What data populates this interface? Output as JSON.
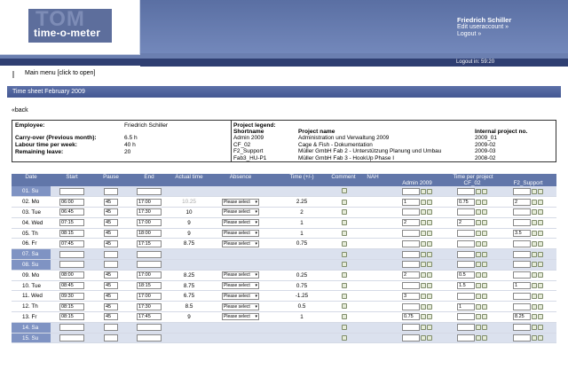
{
  "header": {
    "logo_ghost": "TOM",
    "logo_text": "time-o-meter",
    "user_name": "Friedrich Schiller",
    "edit_account": "Edit useraccount »",
    "logout": "Logout »",
    "logout_time": "Logout in: 59:20"
  },
  "menu": {
    "label": "Main menu [click to open]"
  },
  "sheet": {
    "title": "Time sheet February 2009",
    "back": "«back"
  },
  "employee": {
    "employee_label": "Employee:",
    "employee_value": "Friedrich Schiller",
    "carry_label": "Carry-over (Previous month):",
    "carry_value": "6.5 h",
    "labour_label": "Labour time per week:",
    "labour_value": "40 h",
    "leave_label": "Remaining leave:",
    "leave_value": "20"
  },
  "legend": {
    "title": "Project legend:",
    "col_short": "Shortname",
    "col_name": "Project name",
    "col_no": "Internal project no.",
    "rows": [
      {
        "short": "Admin 2009",
        "name": "Administration und Verwaltung 2009",
        "no": "2009_01"
      },
      {
        "short": "CF_02",
        "name": "Cage & Fish - Dokumentation",
        "no": "2009-02"
      },
      {
        "short": "F2_Support",
        "name": "Müller GmbH Fab 2 - Unterstützung Planung und Umbau",
        "no": "2009-03"
      },
      {
        "short": "Fab3_HU-P1",
        "name": "Müller GmbH Fab 3 - HookUp Phase I",
        "no": "2008-02"
      }
    ]
  },
  "table": {
    "headers": {
      "date": "Date",
      "start": "Start",
      "pause": "Pause",
      "end": "End",
      "actual": "Actual time",
      "absence": "Absence",
      "time": "Time (+/-)",
      "comment": "Comment",
      "nah": "NAH",
      "per_project": "Time per project",
      "p1": "Admin 2009",
      "p2": "CF_02",
      "p3": "F2_Support"
    },
    "select_placeholder": "Please select",
    "rows": [
      {
        "date": "01. Su",
        "weekend": true,
        "start": "",
        "pause": "",
        "end": "",
        "actual": "",
        "absence": false,
        "time": "",
        "p1": "",
        "p2": "",
        "p3": ""
      },
      {
        "date": "02. Mo",
        "weekend": false,
        "start": "06:00",
        "pause": "45",
        "end": "17:00",
        "actual": "10.25",
        "faint": true,
        "absence": true,
        "time": "2.25",
        "p1": "1",
        "p2": "0.75",
        "p3": "2"
      },
      {
        "date": "03. Tue",
        "weekend": false,
        "start": "06:45",
        "pause": "45",
        "end": "17:30",
        "actual": "10",
        "absence": true,
        "time": "2",
        "p1": "",
        "p2": "",
        "p3": ""
      },
      {
        "date": "04. Wed",
        "weekend": false,
        "start": "07:15",
        "pause": "45",
        "end": "17:00",
        "actual": "9",
        "absence": true,
        "time": "1",
        "p1": "2",
        "p2": "2",
        "p3": ""
      },
      {
        "date": "05. Th",
        "weekend": false,
        "start": "08:15",
        "pause": "45",
        "end": "18:00",
        "actual": "9",
        "absence": true,
        "time": "1",
        "p1": "",
        "p2": "",
        "p3": "3.5"
      },
      {
        "date": "06. Fr",
        "weekend": false,
        "start": "07:45",
        "pause": "45",
        "end": "17:15",
        "actual": "8.75",
        "absence": true,
        "time": "0.75",
        "p1": "",
        "p2": "",
        "p3": ""
      },
      {
        "date": "07. Sa",
        "weekend": true,
        "start": "",
        "pause": "",
        "end": "",
        "actual": "",
        "absence": false,
        "time": "",
        "p1": "",
        "p2": "",
        "p3": ""
      },
      {
        "date": "08. Su",
        "weekend": true,
        "start": "",
        "pause": "",
        "end": "",
        "actual": "",
        "absence": false,
        "time": "",
        "p1": "",
        "p2": "",
        "p3": ""
      },
      {
        "date": "09. Mo",
        "weekend": false,
        "start": "08:00",
        "pause": "45",
        "end": "17:00",
        "actual": "8.25",
        "absence": true,
        "time": "0.25",
        "p1": "2",
        "p2": "0.5",
        "p3": ""
      },
      {
        "date": "10. Tue",
        "weekend": false,
        "start": "08:45",
        "pause": "45",
        "end": "18:15",
        "actual": "8.75",
        "absence": true,
        "time": "0.75",
        "p1": "",
        "p2": "1.5",
        "p3": "1"
      },
      {
        "date": "11. Wed",
        "weekend": false,
        "start": "09:30",
        "pause": "45",
        "end": "17:00",
        "actual": "6.75",
        "absence": true,
        "time": "-1.25",
        "p1": "3",
        "p2": "",
        "p3": ""
      },
      {
        "date": "12. Th",
        "weekend": false,
        "start": "08:15",
        "pause": "45",
        "end": "17:30",
        "actual": "8.5",
        "absence": true,
        "time": "0.5",
        "p1": "",
        "p2": "1",
        "p3": ""
      },
      {
        "date": "13. Fr",
        "weekend": false,
        "start": "08:15",
        "pause": "45",
        "end": "17:45",
        "actual": "9",
        "absence": true,
        "time": "1",
        "p1": "0.75",
        "p2": "",
        "p3": "8.25"
      },
      {
        "date": "14. Sa",
        "weekend": true,
        "start": "",
        "pause": "",
        "end": "",
        "actual": "",
        "absence": false,
        "time": "",
        "p1": "",
        "p2": "",
        "p3": ""
      },
      {
        "date": "15. Su",
        "weekend": true,
        "start": "",
        "pause": "",
        "end": "",
        "actual": "",
        "absence": false,
        "time": "",
        "p1": "",
        "p2": "",
        "p3": ""
      }
    ]
  }
}
